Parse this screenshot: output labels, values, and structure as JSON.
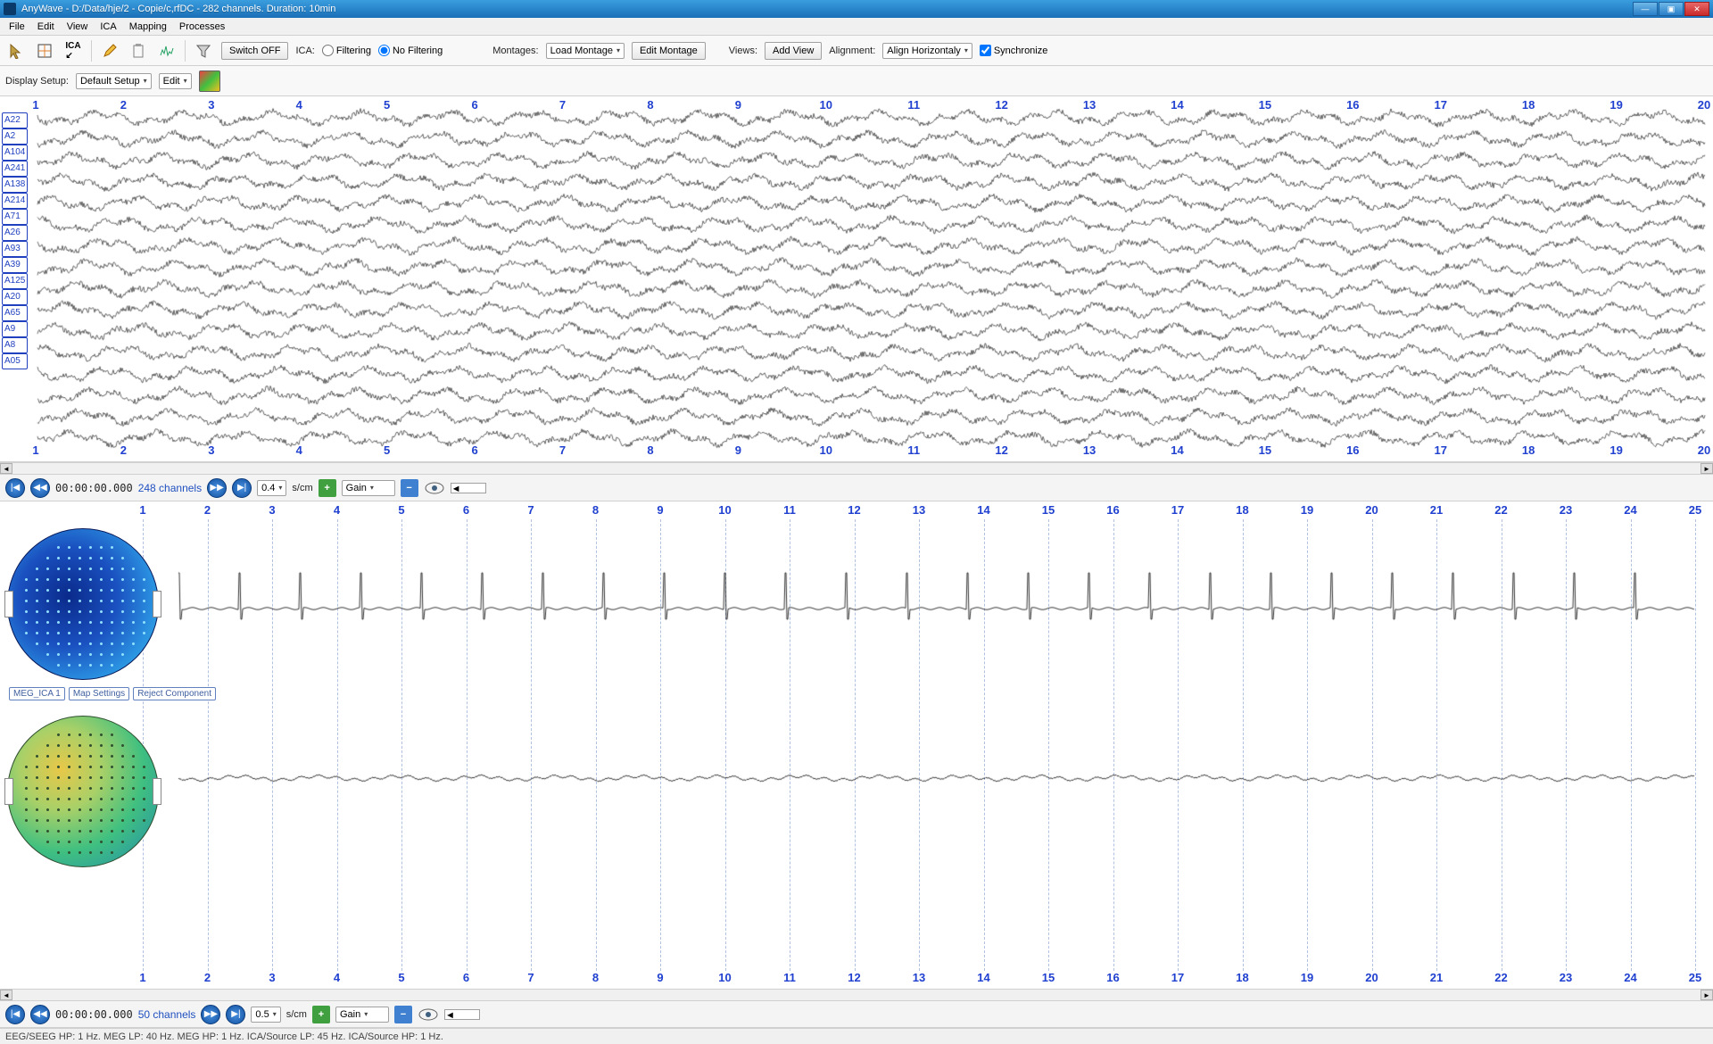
{
  "window": {
    "title": "AnyWave - D:/Data/hje/2 - Copie/c,rfDC - 282 channels. Duration: 10min"
  },
  "menus": [
    "File",
    "Edit",
    "View",
    "ICA",
    "Mapping",
    "Processes"
  ],
  "toolbar": {
    "switchoff": "Switch OFF",
    "ica_lbl": "ICA:",
    "filtering": "Filtering",
    "nofiltering": "No Filtering",
    "montages_lbl": "Montages:",
    "loadmontage": "Load Montage",
    "editmontage": "Edit Montage",
    "views_lbl": "Views:",
    "addview": "Add View",
    "alignment_lbl": "Alignment:",
    "alignh": "Align Horizontaly",
    "sync": "Synchronize",
    "displaysetup_lbl": "Display Setup:",
    "defaultsetup": "Default Setup",
    "edit": "Edit"
  },
  "signal": {
    "channels": [
      "A22",
      "A2",
      "A104",
      "A241",
      "A138",
      "A214",
      "A71",
      "A26",
      "A93",
      "A39",
      "A125",
      "A20",
      "A65",
      "A9",
      "A8",
      "A05"
    ],
    "time_ticks": [
      "1",
      "2",
      "3",
      "4",
      "5",
      "6",
      "7",
      "8",
      "9",
      "10",
      "11",
      "12",
      "13",
      "14",
      "15",
      "16",
      "17",
      "18",
      "19",
      "20"
    ]
  },
  "ctrl1": {
    "time": "00:00:00.000",
    "channels": "248 channels",
    "scm": "0.4",
    "unit": "s/cm",
    "gain": "Gain"
  },
  "ica": {
    "time_ticks": [
      "1",
      "2",
      "3",
      "4",
      "5",
      "6",
      "7",
      "8",
      "9",
      "10",
      "11",
      "12",
      "13",
      "14",
      "15",
      "16",
      "17",
      "18",
      "19",
      "20",
      "21",
      "22",
      "23",
      "24",
      "25"
    ],
    "comp_label": "MEG_ICA 1",
    "mapset": "Map Settings",
    "reject": "Reject Component"
  },
  "ctrl2": {
    "time": "00:00:00.000",
    "channels": "50 channels",
    "scm": "0.5",
    "unit": "s/cm",
    "gain": "Gain"
  },
  "status": "EEG/SEEG HP: 1 Hz. MEG LP: 40 Hz. MEG HP: 1 Hz. ICA/Source LP: 45 Hz. ICA/Source HP: 1 Hz."
}
